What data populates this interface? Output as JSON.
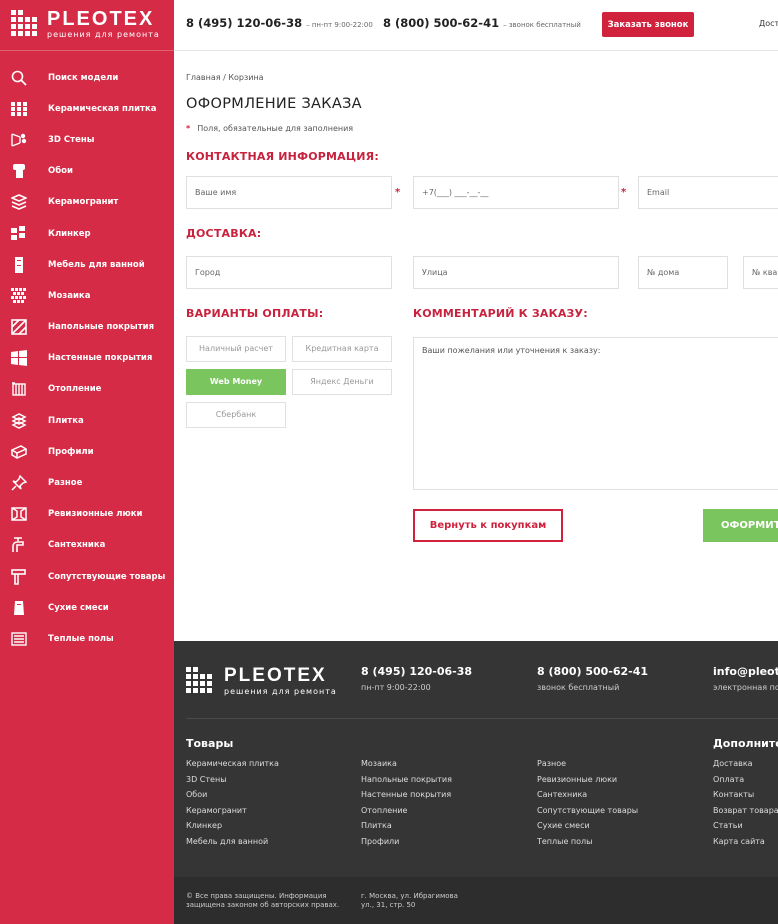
{
  "brand": {
    "name": "PLEOTEX",
    "tagline": "решения для ремонта"
  },
  "header": {
    "phone1": "8 (495) 120-06-38",
    "phone1_note": "– пн-пт 9:00-22:00",
    "phone2": "8 (800) 500-62-41",
    "phone2_note": "– звонок бесплатный",
    "call_button": "Заказать звонок",
    "more": "Дост"
  },
  "sidebar": {
    "items": [
      {
        "label": "Поиск модели",
        "icon": "search-icon"
      },
      {
        "label": "Керамическая плитка",
        "icon": "tiles-grid-icon"
      },
      {
        "label": "3D Стены",
        "icon": "3d-wall-icon"
      },
      {
        "label": "Обои",
        "icon": "wallpaper-roll-icon"
      },
      {
        "label": "Керамогранит",
        "icon": "layers-icon"
      },
      {
        "label": "Клинкер",
        "icon": "clinker-blocks-icon"
      },
      {
        "label": "Мебель для ванной",
        "icon": "cabinet-icon"
      },
      {
        "label": "Мозаика",
        "icon": "mosaic-icon"
      },
      {
        "label": "Напольные покрытия",
        "icon": "floor-icon"
      },
      {
        "label": "Настенные покрытия",
        "icon": "wall-panels-icon"
      },
      {
        "label": "Отопление",
        "icon": "radiator-icon"
      },
      {
        "label": "Плитка",
        "icon": "tile-stack-icon"
      },
      {
        "label": "Профили",
        "icon": "profile-icon"
      },
      {
        "label": "Разное",
        "icon": "pin-icon"
      },
      {
        "label": "Ревизионные люки",
        "icon": "hatch-icon"
      },
      {
        "label": "Сантехника",
        "icon": "faucet-icon"
      },
      {
        "label": "Сопутствующие товары",
        "icon": "tools-icon"
      },
      {
        "label": "Сухие смеси",
        "icon": "bag-icon"
      },
      {
        "label": "Теплые полы",
        "icon": "heated-floor-icon"
      }
    ]
  },
  "main": {
    "breadcrumb": "Главная / Корзина",
    "title": "ОФОРМЛЕНИЕ ЗАКАЗА",
    "required_note": "Поля, обязательные для заполнения",
    "contact_title": "КОНТАКТНАЯ ИНФОРМАЦИЯ:",
    "name_placeholder": "Ваше имя",
    "phone_placeholder": "+7(___) ___-__-__",
    "email_placeholder": "Email",
    "delivery_title": "ДОСТАВКА:",
    "city_placeholder": "Город",
    "street_placeholder": "Улица",
    "house_placeholder": "№ дома",
    "flat_placeholder": "№ квар",
    "payment_title": "ВАРИАНТЫ ОПЛАТЫ:",
    "payments": [
      "Наличный расчет",
      "Кредитная карта",
      "Web Money",
      "Яндекс Деньги",
      "Сбербанк"
    ],
    "payment_selected": "Web Money",
    "comment_title": "КОММЕНТАРИЙ К ЗАКАЗУ:",
    "comment_placeholder": "Ваши пожелания или уточнения к заказу:",
    "back_button": "Вернуть к покупкам",
    "order_button": "ОФОРМИТ"
  },
  "footer": {
    "phone1": "8 (495) 120-06-38",
    "phone1_note": "пн-пт 9:00-22:00",
    "phone2": "8 (800) 500-62-41",
    "phone2_note": "звонок бесплатный",
    "email": "info@pleotex",
    "email_note": "электронная по",
    "goods_title": "Товары",
    "extra_title": "Дополнител",
    "col1": [
      "Керамическая плитка",
      "3D Стены",
      "Обои",
      "Керамогранит",
      "Клинкер",
      "Мебель для ванной"
    ],
    "col2": [
      "Мозаика",
      "Напольные покрытия",
      "Настенные покрытия",
      "Отопление",
      "Плитка",
      "Профили"
    ],
    "col3": [
      "Разное",
      "Ревизионные люки",
      "Сантехника",
      "Сопутствующие товары",
      "Сухие смеси",
      "Теплые полы"
    ],
    "col4": [
      "Доставка",
      "Оплата",
      "Контакты",
      "Возврат товара",
      "Статьи",
      "Карта сайта"
    ],
    "copyright_1": "© Все права защищены. Информация",
    "copyright_2": "защищена законом об авторских правах.",
    "address_1": "г. Москва, ул. Ибрагимова",
    "address_2": "ул., 31, стр. 50"
  },
  "colors": {
    "brand_red": "#d52b46",
    "accent_green": "#7ac55e",
    "footer_dark": "#353535"
  }
}
